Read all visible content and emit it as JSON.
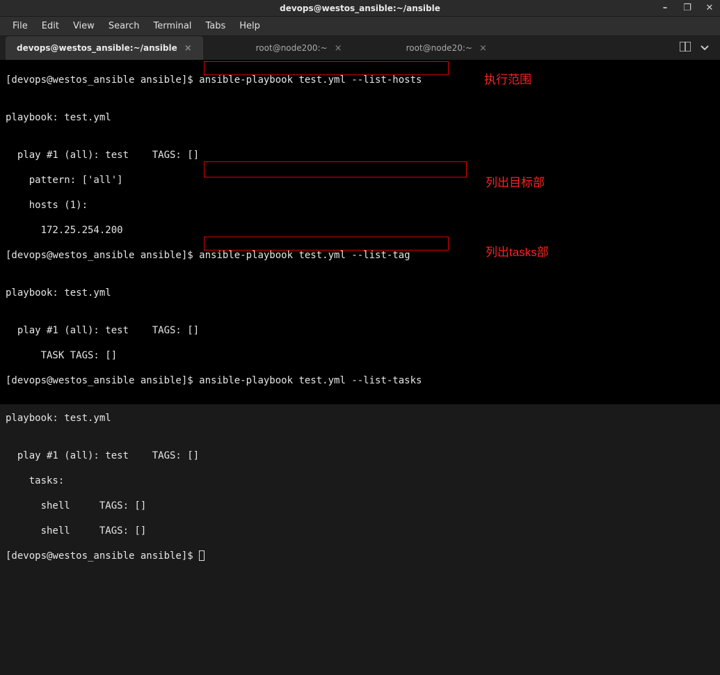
{
  "titlebar": {
    "title": "devops@westos_ansible:~/ansible"
  },
  "window_controls": {
    "minimize": "–",
    "maximize": "❐",
    "close": "✕"
  },
  "menubar": {
    "file": "File",
    "edit": "Edit",
    "view": "View",
    "search": "Search",
    "terminal": "Terminal",
    "tabs": "Tabs",
    "help": "Help"
  },
  "tabs": {
    "t0": {
      "label": "devops@westos_ansible:~/ansible"
    },
    "t1": {
      "label": "root@node200:~"
    },
    "t2": {
      "label": "root@node20:~"
    }
  },
  "terminal": {
    "prompt": "[devops@westos_ansible ansible]$ ",
    "cmd1": "ansible-playbook test.yml --list-hosts",
    "blank": "",
    "out_pb": "playbook: test.yml",
    "out_play_all": "  play #1 (all): test    TAGS: []",
    "out_pattern": "    pattern: ['all']",
    "out_hosts": "    hosts (1):",
    "out_ip": "      172.25.254.200",
    "cmd2": "ansible-playbook test.yml --list-tag",
    "out_tasktags": "      TASK TAGS: []",
    "cmd3": "ansible-playbook test.yml --list-tasks",
    "out_tasks": "    tasks:",
    "out_shell": "      shell     TAGS: []"
  },
  "annotations": {
    "a1": "执行范围",
    "a2": "列出目标部",
    "a3": "列出tasks部"
  }
}
